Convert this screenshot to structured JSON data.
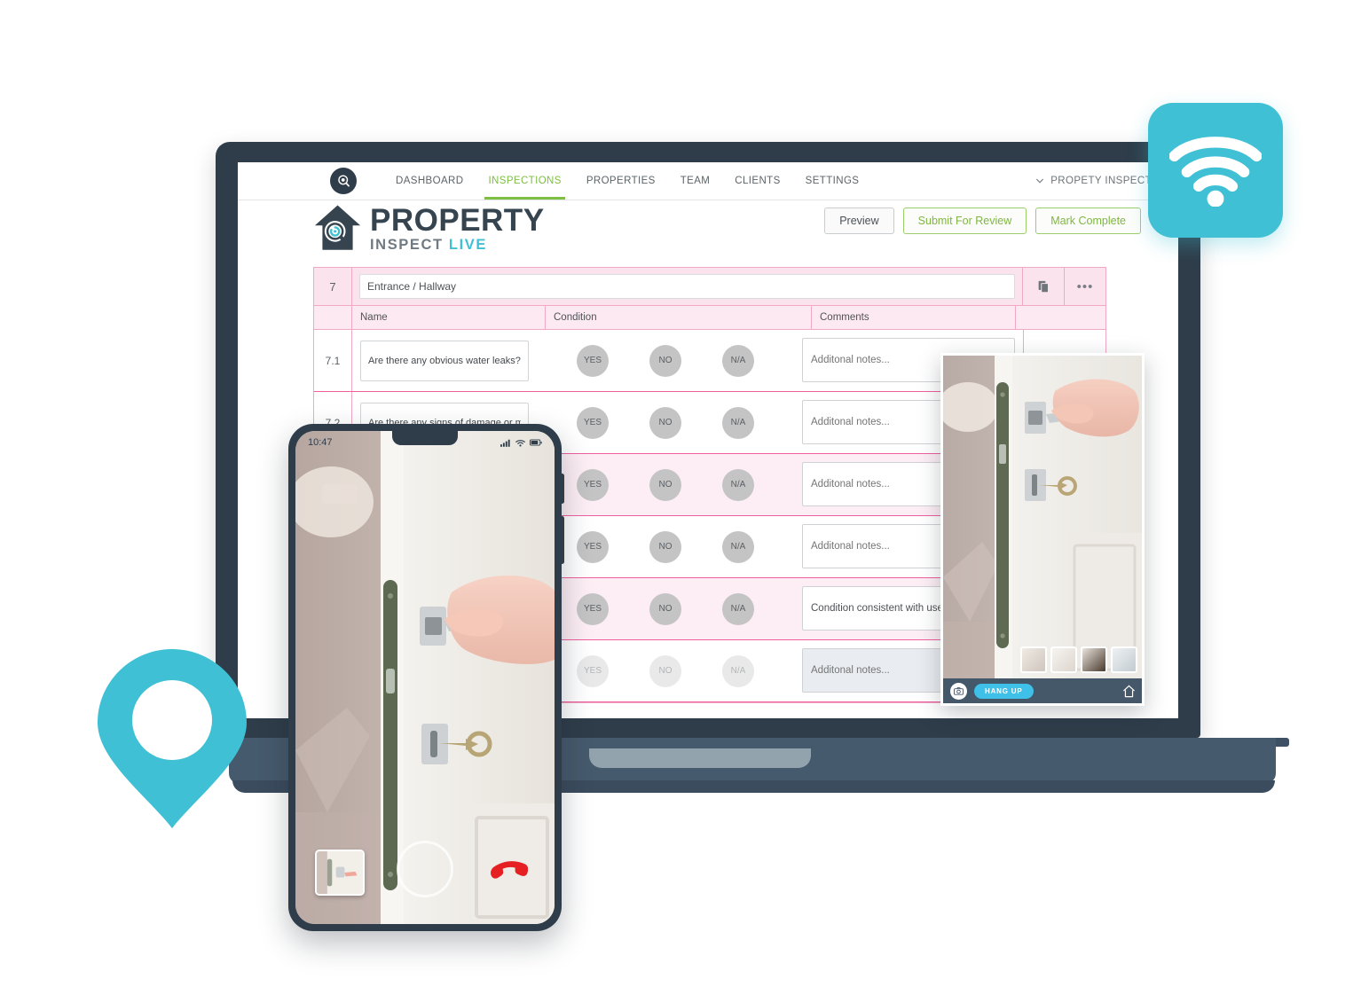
{
  "app": {
    "brand_icon": "property-inspect-mark",
    "nav": [
      {
        "label": "DASHBOARD",
        "active": false
      },
      {
        "label": "INSPECTIONS",
        "active": true
      },
      {
        "label": "PROPERTIES",
        "active": false
      },
      {
        "label": "TEAM",
        "active": false
      },
      {
        "label": "CLIENTS",
        "active": false
      },
      {
        "label": "SETTINGS",
        "active": false
      }
    ],
    "account_menu": "PROPETY INSPECT",
    "account_chevron_icon": "chevron-down-icon"
  },
  "logo": {
    "title": "PROPERTY",
    "sub_left": "INSPECT",
    "sub_right": "LIVE",
    "mark_icon": "house-magnifier-icon"
  },
  "actions": {
    "preview": "Preview",
    "submit_for_review": "Submit For Review",
    "mark_complete": "Mark Complete"
  },
  "inspection": {
    "section_number": "7",
    "section_title": "Entrance / Hallway",
    "section_copy_icon": "copy-icon",
    "section_more_icon": "more-options-icon",
    "columns": {
      "number": "",
      "name": "Name",
      "condition": "Condition",
      "comments": "Comments",
      "actions": ""
    },
    "condition_options": [
      "YES",
      "NO",
      "N/A"
    ],
    "row_more_icon": "more-options-icon",
    "rows": [
      {
        "number": "7.1",
        "question": "Are there any obvious water leaks?",
        "comment": "Additonal notes...",
        "comment_is_placeholder": true,
        "disabled": false,
        "shaded": false,
        "show_more": true
      },
      {
        "number": "7.2",
        "question": "Are there any signs of damage or mould?",
        "comment": "Additonal notes...",
        "comment_is_placeholder": true,
        "disabled": false,
        "shaded": false,
        "show_more": false
      },
      {
        "number": "",
        "question": "",
        "comment": "Additonal notes...",
        "comment_is_placeholder": true,
        "disabled": false,
        "shaded": true,
        "show_more": false
      },
      {
        "number": "",
        "question": "",
        "comment": "Additonal notes...",
        "comment_is_placeholder": true,
        "disabled": false,
        "shaded": false,
        "show_more": false
      },
      {
        "number": "",
        "question": "",
        "comment": "Condition consistent with use",
        "comment_is_placeholder": false,
        "disabled": false,
        "shaded": true,
        "show_more": false
      },
      {
        "number": "",
        "question": "",
        "comment": "Additonal notes...",
        "comment_is_placeholder": true,
        "disabled": true,
        "shaded": false,
        "show_more": false
      }
    ]
  },
  "phone": {
    "status_time": "10:47",
    "signal_icon": "signal-bars-icon",
    "wifi_icon": "wifi-icon",
    "battery_icon": "battery-icon",
    "thumbnail_icon": "photo-thumbnail",
    "shutter_icon": "camera-shutter-button",
    "hangup_icon": "phone-hangup-icon"
  },
  "video_call": {
    "camera_icon": "camera-icon",
    "hangup_label": "HANG UP",
    "home_icon": "home-icon",
    "thumbnail_count": 4
  },
  "badges": {
    "wifi_icon": "wifi-icon",
    "location_pin_icon": "map-pin-icon"
  },
  "colors": {
    "accent_cyan": "#3fc0d4",
    "accent_green": "#7dbf43",
    "table_pink": "#ef5fa0",
    "table_pink_light": "#f0a8c4",
    "device_navy": "#2f3d4a"
  }
}
